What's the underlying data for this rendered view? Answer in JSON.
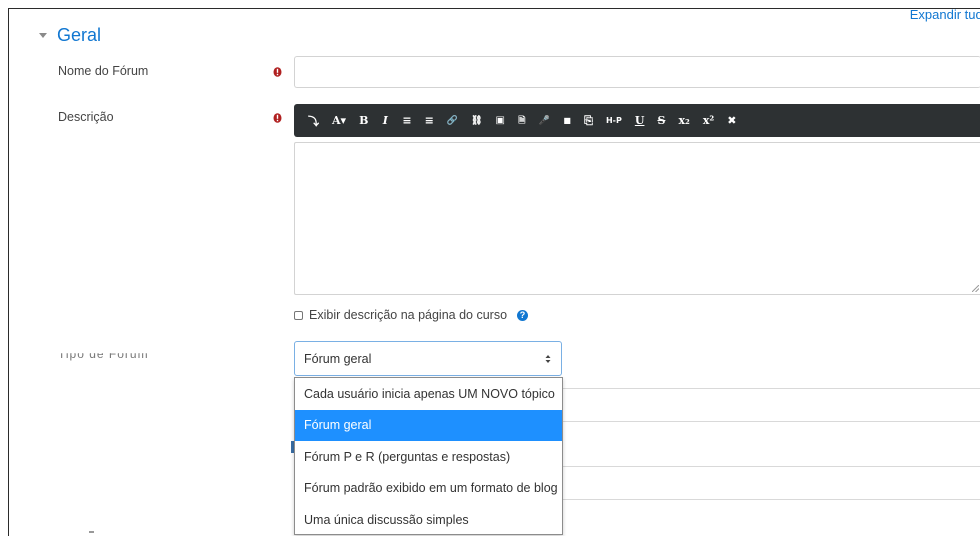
{
  "header": {
    "expand_all": "Expandir tudo"
  },
  "section": {
    "title": "Geral"
  },
  "form": {
    "forum_name": {
      "label": "Nome do Fórum",
      "value": ""
    },
    "description": {
      "label": "Descrição",
      "toolbar": [
        "⤵",
        "A▾",
        "B",
        "I",
        "≡",
        "≡",
        "🔗",
        "⛓",
        "▣",
        "🗎",
        "🎤",
        "■",
        "⎘",
        "H-P",
        "U",
        "S",
        "x₂",
        "x²",
        "✖"
      ],
      "content": ""
    },
    "show_description": {
      "label": "Exibir descrição na página do curso",
      "checked": false
    },
    "forum_type": {
      "label": "Tipo de Fórum",
      "selected": "Fórum geral",
      "options": [
        "Cada usuário inicia apenas UM NOVO tópico",
        "Fórum geral",
        "Fórum P e R (perguntas e respostas)",
        "Fórum padrão exibido em um formato de blog",
        "Uma única discussão simples"
      ],
      "highlighted_index": 1
    }
  },
  "colors": {
    "accent": "#1177d1",
    "toolbar_bg": "#2d3133",
    "highlight": "#1e90ff",
    "required": "#b02020"
  }
}
